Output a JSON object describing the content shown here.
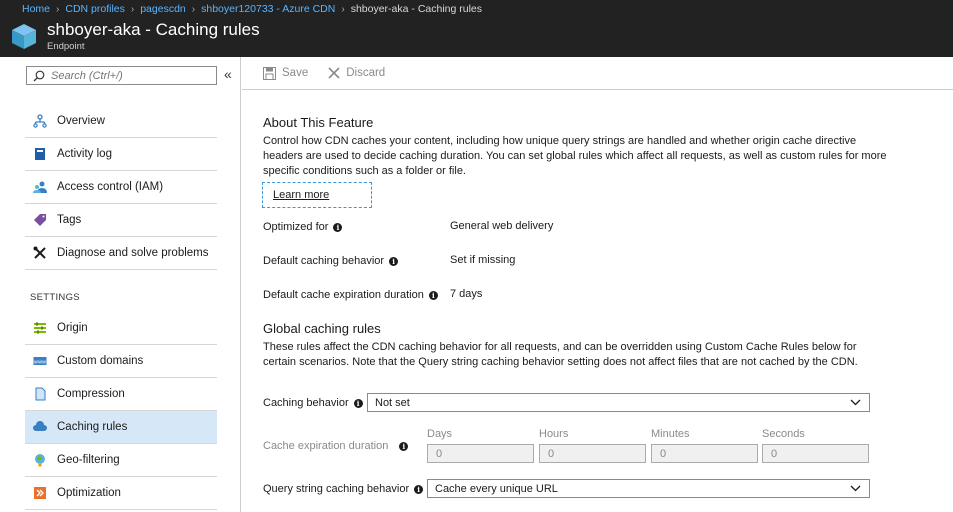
{
  "breadcrumb": {
    "items": [
      "Home",
      "CDN profiles",
      "pagescdn",
      "shboyer120733 - Azure CDN"
    ],
    "current": "shboyer-aka - Caching rules"
  },
  "header": {
    "title": "shboyer-aka - Caching rules",
    "subtitle": "Endpoint",
    "icon": "cube-icon"
  },
  "search": {
    "placeholder": "Search (Ctrl+/)"
  },
  "nav": {
    "items": [
      {
        "label": "Overview",
        "icon": "overview-icon"
      },
      {
        "label": "Activity log",
        "icon": "activity-log-icon"
      },
      {
        "label": "Access control (IAM)",
        "icon": "iam-icon"
      },
      {
        "label": "Tags",
        "icon": "tag-icon"
      },
      {
        "label": "Diagnose and solve problems",
        "icon": "wrench-icon"
      }
    ],
    "settings_label": "SETTINGS",
    "settings_items": [
      {
        "label": "Origin",
        "icon": "origin-icon"
      },
      {
        "label": "Custom domains",
        "icon": "custom-domains-icon"
      },
      {
        "label": "Compression",
        "icon": "compression-icon"
      },
      {
        "label": "Caching rules",
        "icon": "cloud-icon",
        "selected": true
      },
      {
        "label": "Geo-filtering",
        "icon": "globe-icon"
      },
      {
        "label": "Optimization",
        "icon": "optimization-icon"
      }
    ]
  },
  "toolbar": {
    "save_label": "Save",
    "discard_label": "Discard"
  },
  "about": {
    "title": "About This Feature",
    "lines": [
      "Control how CDN caches your content, including how unique query strings are handled and whether origin cache directive",
      "headers are used to decide caching duration. You can set global rules which affect all requests, as well as custom rules for more",
      "specific conditions such as a folder or file."
    ],
    "learn_more": "Learn more"
  },
  "settings": {
    "optimized_for": {
      "label": "Optimized for",
      "value": "General web delivery"
    },
    "default_caching": {
      "label": "Default caching behavior",
      "value": "Set if missing"
    },
    "default_expiration": {
      "label": "Default cache expiration duration",
      "value": "7 days"
    }
  },
  "global": {
    "title": "Global caching rules",
    "lines": [
      "These rules affect the CDN caching behavior for all requests, and can be overridden using Custom Cache Rules below for",
      "certain scenarios. Note that the Query string caching behavior setting does not affect files that are not cached by the CDN."
    ],
    "caching_behavior": {
      "label": "Caching behavior",
      "value": "Not set"
    },
    "expiration": {
      "label": "Cache expiration duration",
      "fields": [
        {
          "label": "Days",
          "value": "0"
        },
        {
          "label": "Hours",
          "value": "0"
        },
        {
          "label": "Minutes",
          "value": "0"
        },
        {
          "label": "Seconds",
          "value": "0"
        }
      ]
    },
    "query_string": {
      "label": "Query string caching behavior",
      "value": "Cache every unique URL"
    }
  }
}
